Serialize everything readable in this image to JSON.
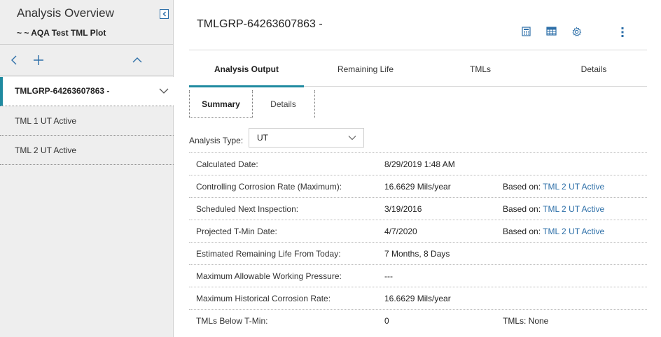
{
  "sidebar": {
    "title": "Analysis Overview",
    "subtitle": "~ ~ AQA Test TML Plot",
    "group_label": "TMLGRP-64263607863 -",
    "items": [
      {
        "label": "TML 1 UT Active"
      },
      {
        "label": "TML 2 UT Active"
      }
    ]
  },
  "header": {
    "title": "TMLGRP-64263607863 -"
  },
  "tabs": [
    {
      "label": "Analysis Output",
      "active": true
    },
    {
      "label": "Remaining Life",
      "active": false
    },
    {
      "label": "TMLs",
      "active": false
    },
    {
      "label": "Details",
      "active": false
    }
  ],
  "subtabs": [
    {
      "label": "Summary",
      "active": true
    },
    {
      "label": "Details",
      "active": false
    }
  ],
  "analysis_type": {
    "label": "Analysis Type:",
    "value": "UT"
  },
  "summary_rows": [
    {
      "label": "Calculated Date:",
      "value": "8/29/2019 1:48 AM",
      "based_prefix": "",
      "based_link": ""
    },
    {
      "label": "Controlling Corrosion Rate (Maximum):",
      "value": "16.6629 Mils/year",
      "based_prefix": "Based on:",
      "based_link": "TML 2 UT Active"
    },
    {
      "label": "Scheduled Next Inspection:",
      "value": "3/19/2016",
      "based_prefix": "Based on:",
      "based_link": "TML 2 UT Active"
    },
    {
      "label": "Projected T-Min Date:",
      "value": "4/7/2020",
      "based_prefix": "Based on:",
      "based_link": "TML 2 UT Active"
    },
    {
      "label": "Estimated Remaining Life From Today:",
      "value": "7 Months, 8 Days",
      "based_prefix": "",
      "based_link": ""
    },
    {
      "label": "Maximum Allowable Working Pressure:",
      "value": "---",
      "based_prefix": "",
      "based_link": ""
    },
    {
      "label": "Maximum Historical Corrosion Rate:",
      "value": "16.6629 Mils/year",
      "based_prefix": "",
      "based_link": ""
    },
    {
      "label": "TMLs Below T-Min:",
      "value": "0",
      "based_prefix": "TMLs: None",
      "based_link": ""
    }
  ],
  "colors": {
    "accent": "#1f8aa0",
    "link": "#2d6fa8",
    "sidebar_bg": "#eeeeee"
  },
  "icons": {
    "collapse": "collapse-left-icon",
    "back": "chevron-left-icon",
    "add": "plus-icon",
    "collapse_up": "chevron-up-icon",
    "group_chev": "chevron-down-icon",
    "calculator": "calculator-icon",
    "table": "table-icon",
    "settings": "gear-icon",
    "more": "more-vertical-icon"
  }
}
